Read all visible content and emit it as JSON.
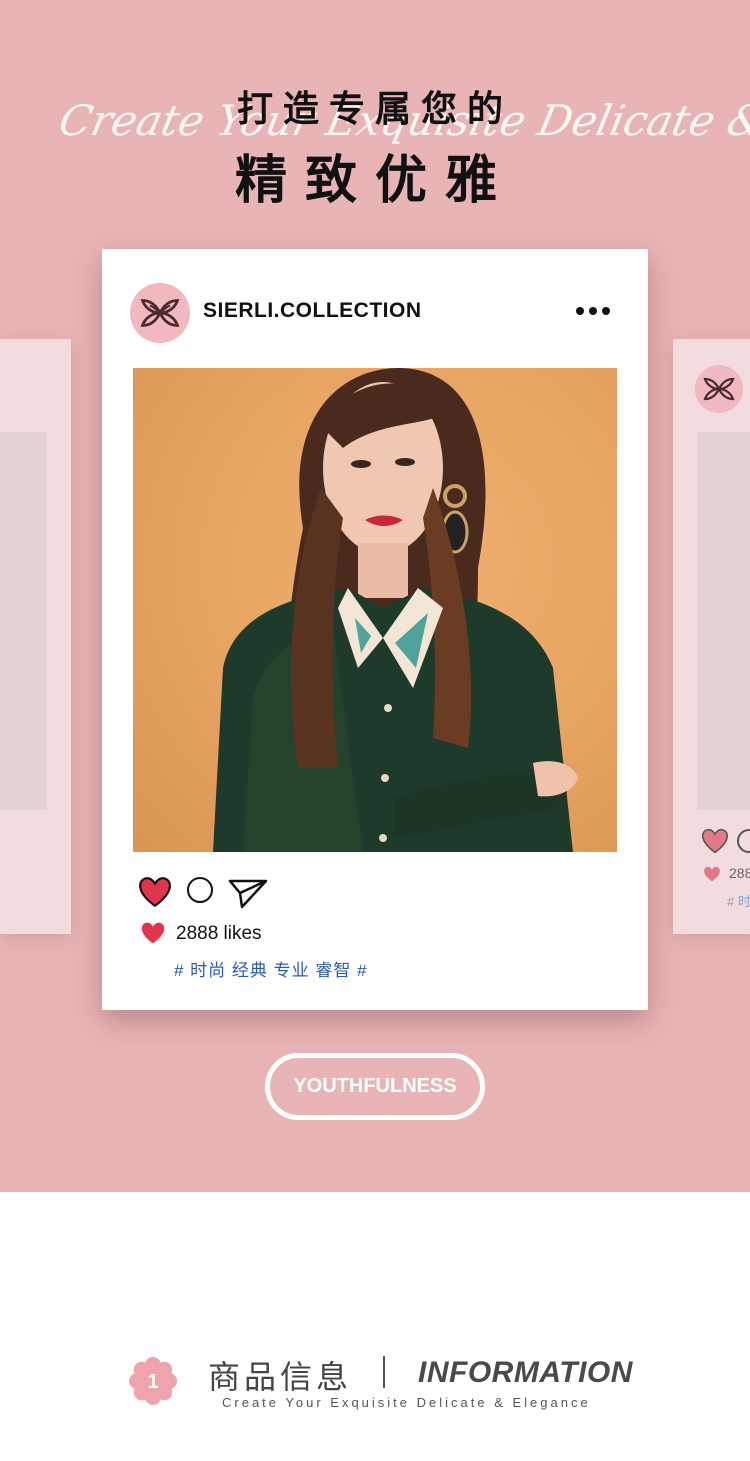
{
  "banner": {
    "script_text": "Create Your Exquisite Delicate & Elegance",
    "title_line1": "打造专属您的",
    "title_line2": "精致优雅"
  },
  "post": {
    "account_name": "SIERLI.COLLECTION",
    "likes_text": "2888 likes",
    "tags_text": "# 时尚 经典 专业 睿智 #",
    "icons": [
      "logo-icon",
      "more-icon",
      "heart-icon",
      "comment-icon",
      "send-icon"
    ]
  },
  "side_card": {
    "likes_text": "288",
    "tags_text": "# 时"
  },
  "badge": {
    "label": "YOUTHFULNESS"
  },
  "info": {
    "number": "1",
    "cn_title": "商品信息",
    "en_title": "INFORMATION",
    "subtitle": "Create Your Exquisite Delicate & Elegance"
  },
  "colors": {
    "background_pink": "#e8b4b5",
    "side_card": "#f3dcdd",
    "heart_red": "#e0354c",
    "tag_blue": "#2a5bb0"
  }
}
